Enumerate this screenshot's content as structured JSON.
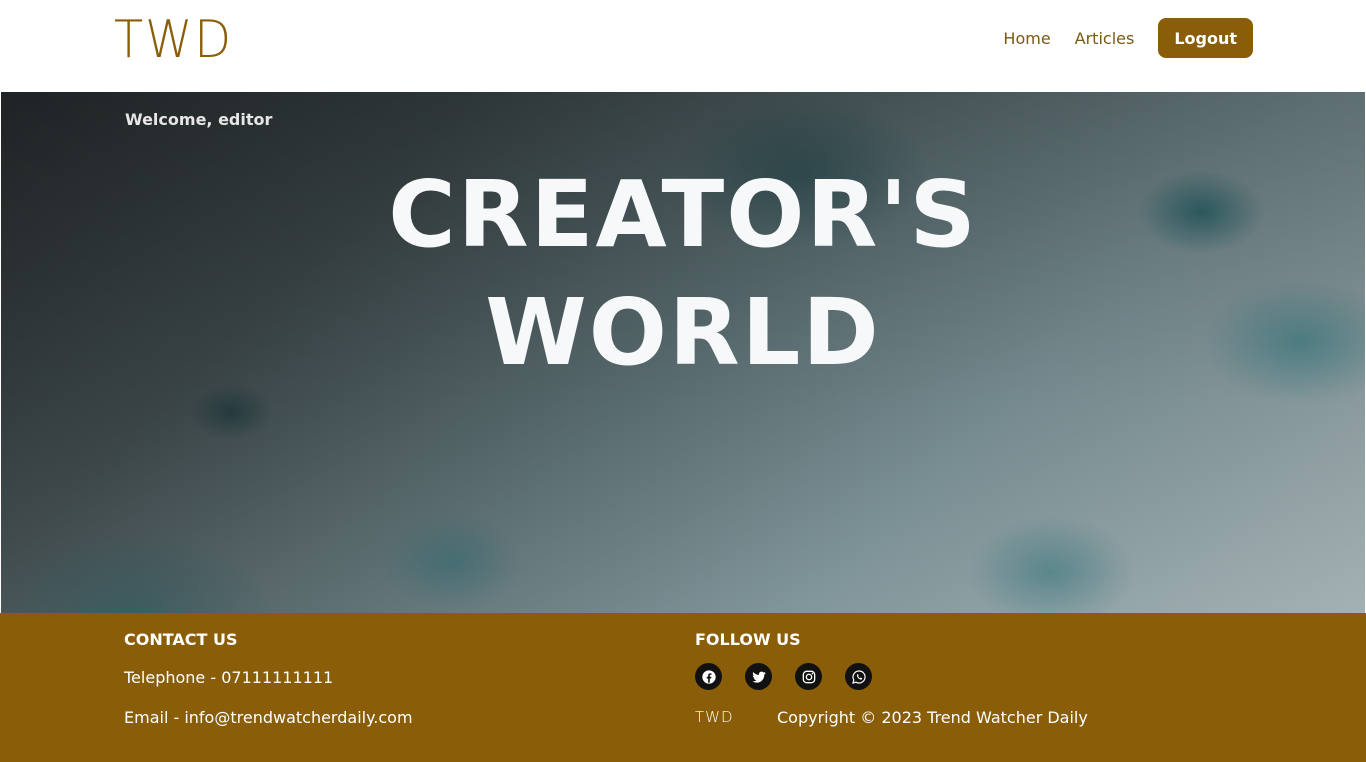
{
  "header": {
    "logo": "TWD",
    "nav": {
      "home": "Home",
      "articles": "Articles",
      "logout": "Logout"
    }
  },
  "hero": {
    "welcome": "Welcome, editor",
    "title_line1": "CREATOR'S",
    "title_line2": "WORLD"
  },
  "footer": {
    "contact": {
      "heading": "CONTACT US",
      "telephone": "Telephone - 07111111111",
      "email": "Email - info@trendwatcherdaily.com"
    },
    "follow": {
      "heading": "FOLLOW US",
      "icons": [
        "facebook-icon",
        "twitter-icon",
        "instagram-icon",
        "whatsapp-icon"
      ]
    },
    "logo": "TWD",
    "copyright": "Copyright © 2023 Trend Watcher Daily"
  },
  "colors": {
    "brand": "#8a5d09",
    "icon_bg": "#111111",
    "hero_text": "#f7f8fa"
  }
}
